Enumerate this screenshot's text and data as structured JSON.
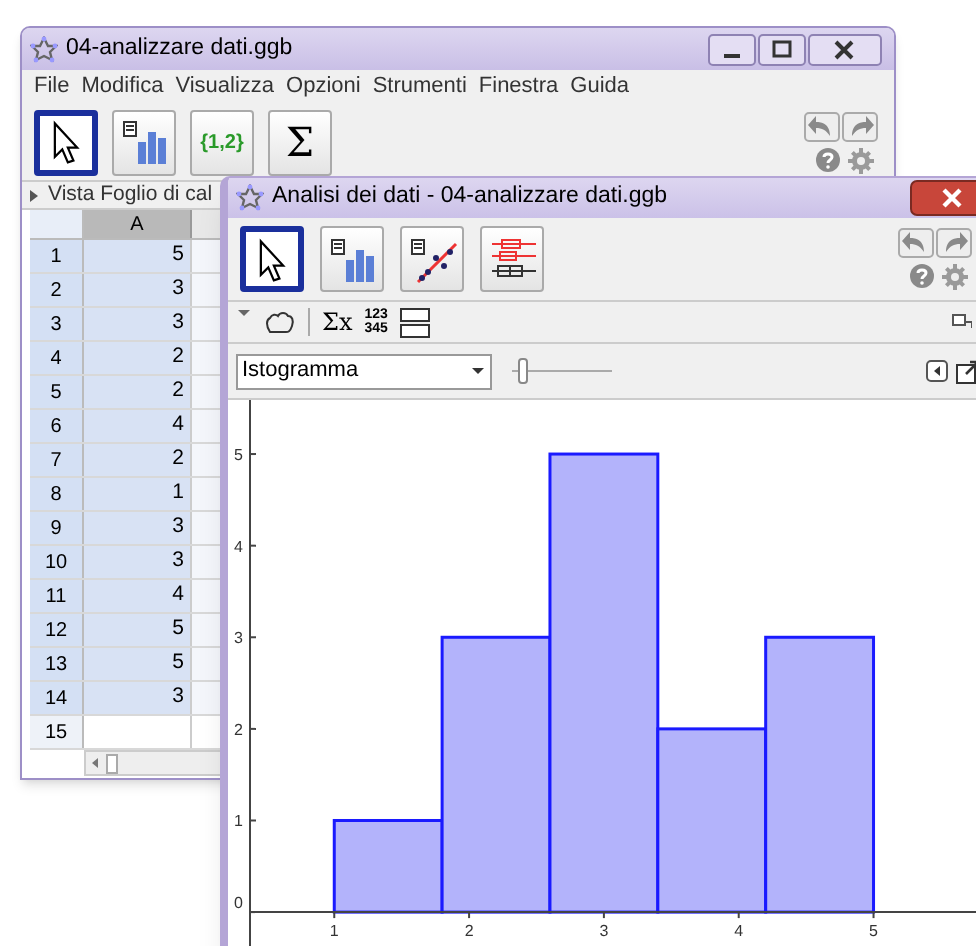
{
  "main_window": {
    "title": "04-analizzare dati.ggb",
    "menu": [
      "File",
      "Modifica",
      "Visualizza",
      "Opzioni",
      "Strumenti",
      "Finestra",
      "Guida"
    ],
    "toolbar": [
      {
        "kind": "move",
        "selected": true
      },
      {
        "kind": "one-variable",
        "selected": false
      },
      {
        "kind": "list",
        "label": "{1,2}",
        "selected": false
      },
      {
        "kind": "sum",
        "label": "Σ",
        "selected": false
      }
    ],
    "spreadsheet": {
      "title": "Vista Foglio di cal",
      "column": {
        "label": "A",
        "selected": true
      },
      "rows": [
        {
          "number": "1",
          "value": "5",
          "selected": true
        },
        {
          "number": "2",
          "value": "3",
          "selected": true
        },
        {
          "number": "3",
          "value": "3",
          "selected": true
        },
        {
          "number": "4",
          "value": "2",
          "selected": true
        },
        {
          "number": "5",
          "value": "2",
          "selected": true
        },
        {
          "number": "6",
          "value": "4",
          "selected": true
        },
        {
          "number": "7",
          "value": "2",
          "selected": true
        },
        {
          "number": "8",
          "value": "1",
          "selected": true
        },
        {
          "number": "9",
          "value": "3",
          "selected": true
        },
        {
          "number": "10",
          "value": "3",
          "selected": true
        },
        {
          "number": "11",
          "value": "4",
          "selected": true
        },
        {
          "number": "12",
          "value": "5",
          "selected": true
        },
        {
          "number": "13",
          "value": "5",
          "selected": true
        },
        {
          "number": "14",
          "value": "3",
          "selected": true
        },
        {
          "number": "15",
          "value": "",
          "selected": false
        }
      ]
    }
  },
  "analysis_window": {
    "title": "Analisi dei dati - 04-analizzare dati.ggb",
    "toolbar": [
      {
        "kind": "move",
        "selected": true
      },
      {
        "kind": "one-variable",
        "selected": false
      },
      {
        "kind": "two-variable",
        "selected": false
      },
      {
        "kind": "multi-variable",
        "selected": false
      }
    ],
    "stats_toolbar": {
      "sum_label": "Σx",
      "number_labels": [
        "123",
        "345"
      ]
    },
    "plot_type": {
      "value": "Istogramma"
    },
    "slider": {
      "level": 0.06
    },
    "chart_data": {
      "type": "bar",
      "x": [
        1.4,
        2.2,
        3,
        3.8,
        4.6
      ],
      "series": [
        {
          "color": "#b3b3fb",
          "values": [
            1,
            3,
            5,
            2,
            3
          ]
        }
      ],
      "xlim": [
        0.375,
        5.76
      ],
      "ylim": [
        -0.37,
        5.59
      ],
      "xticks": [
        1,
        2,
        3,
        4,
        5
      ],
      "yticks": [
        0,
        1,
        2,
        3,
        4,
        5
      ]
    }
  }
}
